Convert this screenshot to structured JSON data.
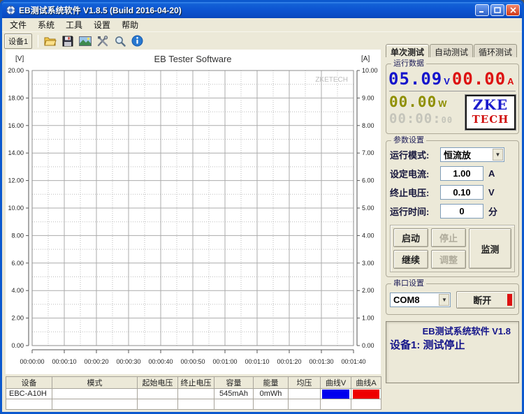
{
  "window": {
    "title": "EB测试系统软件 V1.8.5 (Build 2016-04-20)"
  },
  "menu": {
    "items": [
      "文件",
      "系统",
      "工具",
      "设置",
      "帮助"
    ]
  },
  "toolbar": {
    "device_button": "设备1",
    "icons": [
      "open-folder",
      "save",
      "image",
      "tools",
      "zoom",
      "info"
    ]
  },
  "tabs": [
    {
      "label": "单次测试"
    },
    {
      "label": "自动测试"
    },
    {
      "label": "循环测试"
    }
  ],
  "run_data": {
    "label": "运行数据",
    "voltage": "05.09",
    "voltage_unit": "V",
    "current": "00.00",
    "current_unit": "A",
    "power": "00.00",
    "power_unit": "W",
    "time": "00:00:",
    "time_seconds": "00",
    "logo_line1": "ZKE",
    "logo_line2": "TECH"
  },
  "params": {
    "label": "参数设置",
    "mode_label": "运行模式:",
    "mode_value": "恒流放",
    "current_label": "设定电流:",
    "current_value": "1.00",
    "current_unit": "A",
    "cutoff_label": "终止电压:",
    "cutoff_value": "0.10",
    "cutoff_unit": "V",
    "time_label": "运行时间:",
    "time_value": "0",
    "time_unit": "分",
    "buttons": {
      "start": "启动",
      "stop": "停止",
      "monitor": "监测",
      "resume": "继续",
      "adjust": "调整"
    }
  },
  "serial": {
    "label": "串口设置",
    "port": "COM8",
    "disconnect": "断开"
  },
  "status": {
    "line1": "EB测试系统软件 V1.8",
    "line2": "设备1: 测试停止"
  },
  "table": {
    "headers": [
      "设备",
      "模式",
      "起始电压",
      "终止电压",
      "容量",
      "能量",
      "均压",
      "曲线V",
      "曲线A"
    ],
    "rows": [
      [
        "EBC-A10H",
        "",
        "",
        "",
        "545mAh",
        "0mWh",
        "",
        "",
        ""
      ],
      [
        "",
        "",
        "",
        "",
        "",
        "",
        "",
        "",
        ""
      ]
    ]
  },
  "colors": {
    "voltage": "#1414CC",
    "current": "#DD1111",
    "power": "#8F8F00",
    "time": "#C4C4BA",
    "logo_blue": "#1A1ACC",
    "logo_red": "#D01010",
    "curve_v": "#0000EE",
    "curve_a": "#EE0000",
    "disconnect_bar": "#DD1111"
  },
  "chart_data": {
    "type": "line",
    "title": "EB Tester Software",
    "watermark": "ZKETECH",
    "series": [],
    "left_axis": {
      "label": "[V]",
      "min": 0,
      "max": 20,
      "tick_labels": [
        "20.00",
        "18.00",
        "16.00",
        "14.00",
        "12.00",
        "10.00",
        "8.00",
        "6.00",
        "4.00",
        "2.00",
        "0.00"
      ]
    },
    "right_axis": {
      "label": "[A]",
      "min": 0,
      "max": 10,
      "tick_labels": [
        "10.00",
        "9.00",
        "8.00",
        "7.00",
        "6.00",
        "5.00",
        "4.00",
        "3.00",
        "2.00",
        "1.00",
        "0.00"
      ]
    },
    "x_axis": {
      "tick_labels": [
        "00:00:00",
        "00:00:10",
        "00:00:20",
        "00:00:30",
        "00:00:40",
        "00:00:50",
        "00:01:00",
        "00:01:10",
        "00:01:20",
        "00:01:30",
        "00:01:40"
      ]
    }
  }
}
